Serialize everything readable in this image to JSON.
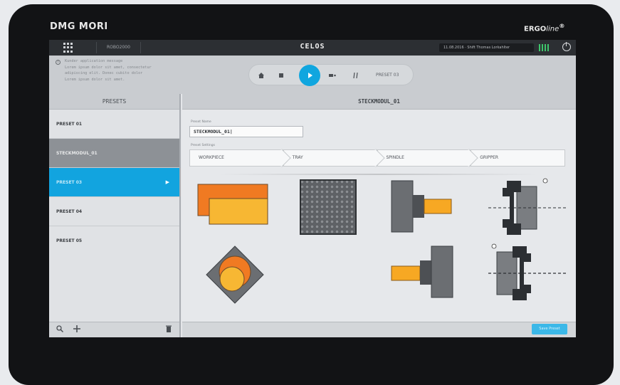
{
  "brand": {
    "left": "DMG MORI",
    "right_main": "ERGO",
    "right_italic": "line",
    "right_reg": "®"
  },
  "topbar": {
    "breadcrumb": "ROBO2000",
    "app_title": "CELOS",
    "status_text": "11.08.2016 · Shift Thomas Lorkahlter",
    "signal_icon": "signal-bars-icon",
    "power_icon": "power-icon"
  },
  "message": {
    "icon": "info-icon",
    "lines": "Kunder application message\nLorem ipsum dolor sit amet, consectetur\nadipiscing elit. Donec cubito dolor\nLorem ipsum dolor sit amet."
  },
  "controls": {
    "home_icon": "home-icon",
    "stop_icon": "stop-icon",
    "play_icon": "play-icon",
    "record_icon": "record-icon",
    "pause_icon": "pause-icon",
    "preset_label": "PRESET 03"
  },
  "presets": {
    "header": "PRESETS",
    "items": [
      {
        "label": "PRESET 01",
        "state": "normal"
      },
      {
        "label": "STECKMODUL_01",
        "state": "editing"
      },
      {
        "label": "PRESET 03",
        "state": "active"
      },
      {
        "label": "PRESET 04",
        "state": "normal"
      },
      {
        "label": "PRESET 05",
        "state": "normal"
      }
    ],
    "footer": {
      "search_icon": "search-icon",
      "add_icon": "plus-icon",
      "delete_icon": "trash-icon"
    }
  },
  "detail": {
    "header": "STECKMODUL_01",
    "name_label": "Preset Name",
    "name_value": "STECKMODUL_01|",
    "settings_label": "Preset Settings",
    "tabs": [
      "WORKPIECE",
      "TRAY",
      "SPINDLE",
      "GRIPPER"
    ],
    "save_label": "Save Preset"
  },
  "colors": {
    "accent": "#12a4df",
    "orange": "#f07a22",
    "yellow": "#f7b733",
    "grey": "#6b6e72"
  }
}
